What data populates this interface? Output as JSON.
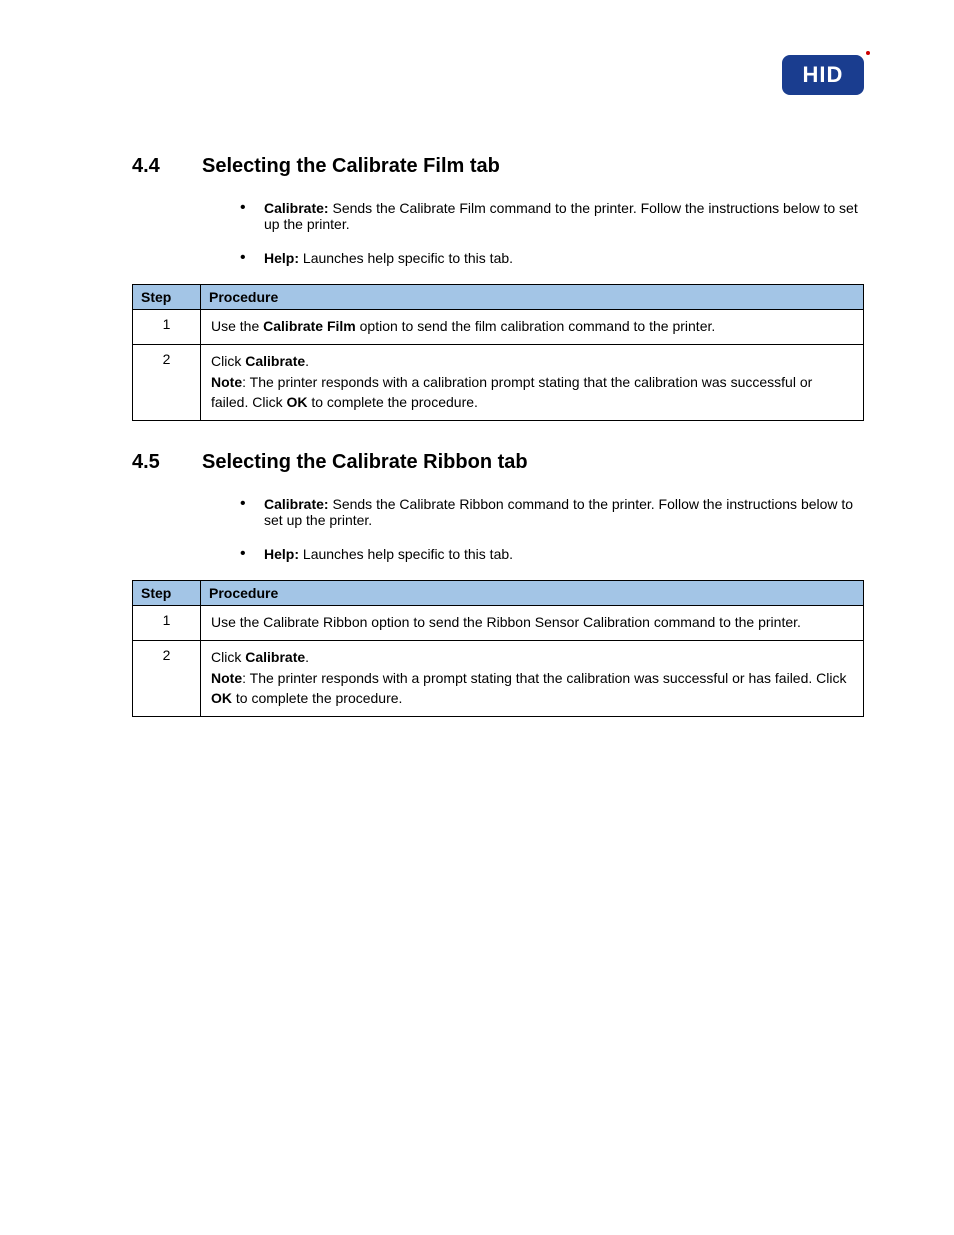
{
  "logo": {
    "text": "HID"
  },
  "section44": {
    "num": "4.4",
    "title": "Selecting the Calibrate Film tab",
    "bullets": [
      {
        "label": "Calibrate",
        "text": "Sends the Calibrate Film command to the printer. Follow the instructions below to set up the printer."
      },
      {
        "label": "Help",
        "text": "Launches help specific to this tab."
      }
    ],
    "table": {
      "head_step": "Step",
      "head_proc": "Procedure",
      "rows": [
        {
          "step": "1",
          "html": "Use the <span class='b'>Calibrate Film</span> option to send the film calibration command to the printer."
        },
        {
          "step": "2",
          "html": "Click <span class='b'>Calibrate</span>.<br><span class='b'>Note</span>: The printer responds with a calibration prompt stating that the calibration was successful or failed. Click <span class='b'>OK</span> to complete the procedure."
        }
      ]
    }
  },
  "section45": {
    "num": "4.5",
    "title": "Selecting the Calibrate Ribbon tab",
    "bullets": [
      {
        "label": "Calibrate",
        "text": "Sends the Calibrate Ribbon command to the printer. Follow the instructions below to set up the printer."
      },
      {
        "label": "Help",
        "text": "Launches help specific to this tab."
      }
    ],
    "table": {
      "head_step": "Step",
      "head_proc": "Procedure",
      "rows": [
        {
          "step": "1",
          "html": "Use the Calibrate Ribbon option to send the Ribbon Sensor Calibration command to the printer."
        },
        {
          "step": "2",
          "html": "Click <span class='b'>Calibrate</span>.<br><span class='b'>Note</span>: The printer responds with a prompt stating that the calibration was successful or has failed. Click <span class='b'>OK</span> to complete the procedure."
        }
      ]
    }
  }
}
